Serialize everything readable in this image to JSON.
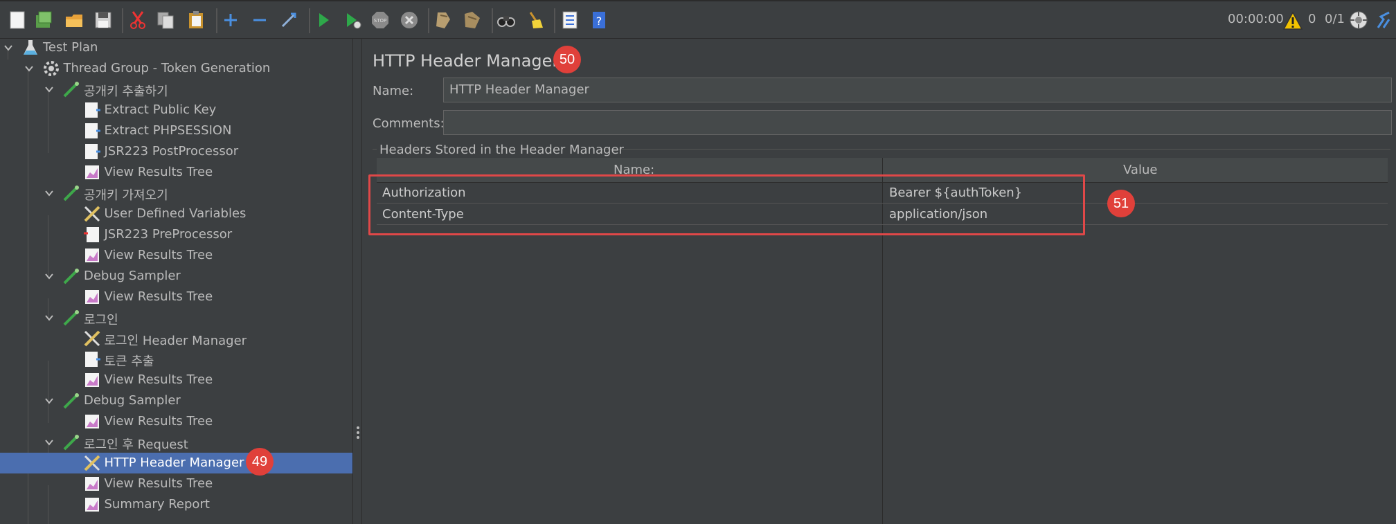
{
  "toolbar": {
    "buttons": [
      "new-icon",
      "templates-icon",
      "open-icon",
      "save-icon",
      "cut-icon",
      "copy-icon",
      "paste-icon",
      "expand-icon",
      "collapse-icon",
      "toggle-icon",
      "start-icon",
      "start-no-pauses-icon",
      "stop-icon",
      "shutdown-icon",
      "clear-icon",
      "clear-all-icon",
      "search-icon",
      "reset-search-icon",
      "function-helper-icon",
      "help-icon"
    ],
    "timer": "00:00:00",
    "warnings": "0",
    "threads": "0/1"
  },
  "tree": {
    "items": [
      {
        "label": "Test Plan",
        "icon": "test-plan-icon"
      },
      {
        "label": "Thread Group - Token Generation",
        "icon": "thread-group-icon"
      },
      {
        "label": "공개키 추출하기",
        "icon": "sampler-icon"
      },
      {
        "label": "Extract Public Key",
        "icon": "post-processor-icon"
      },
      {
        "label": "Extract PHPSESSION",
        "icon": "post-processor-icon"
      },
      {
        "label": "JSR223 PostProcessor",
        "icon": "post-processor-icon"
      },
      {
        "label": "View Results Tree",
        "icon": "listener-icon"
      },
      {
        "label": "공개키 가져오기",
        "icon": "sampler-icon"
      },
      {
        "label": "User Defined Variables",
        "icon": "config-icon"
      },
      {
        "label": "JSR223 PreProcessor",
        "icon": "pre-processor-icon"
      },
      {
        "label": "View Results Tree",
        "icon": "listener-icon"
      },
      {
        "label": "Debug Sampler",
        "icon": "sampler-icon"
      },
      {
        "label": "View Results Tree",
        "icon": "listener-icon"
      },
      {
        "label": "로그인",
        "icon": "sampler-icon"
      },
      {
        "label": "로그인 Header Manager",
        "icon": "config-icon"
      },
      {
        "label": "토큰 추출",
        "icon": "post-processor-icon"
      },
      {
        "label": "View Results Tree",
        "icon": "listener-icon"
      },
      {
        "label": "Debug Sampler",
        "icon": "sampler-icon"
      },
      {
        "label": "View Results Tree",
        "icon": "listener-icon"
      },
      {
        "label": "로그인 후 Request",
        "icon": "sampler-icon"
      },
      {
        "label": "HTTP Header Manager",
        "icon": "config-icon"
      },
      {
        "label": "View Results Tree",
        "icon": "listener-icon"
      },
      {
        "label": "Summary Report",
        "icon": "listener-icon"
      }
    ]
  },
  "panel": {
    "title": "HTTP Header Manager",
    "name_label": "Name:",
    "name_value": "HTTP Header Manager",
    "comments_label": "Comments:",
    "comments_value": "",
    "group_title": "Headers Stored in the Header Manager",
    "columns": [
      "Name:",
      "Value"
    ],
    "rows": [
      {
        "name": "Authorization",
        "value": "Bearer ${authToken}"
      },
      {
        "name": "Content-Type",
        "value": "application/json"
      }
    ]
  },
  "annotations": {
    "badge_tree": "49",
    "badge_title": "50",
    "badge_table": "51"
  },
  "colors": {
    "selection": "#4b6eaf",
    "annotation": "#e0403a"
  }
}
